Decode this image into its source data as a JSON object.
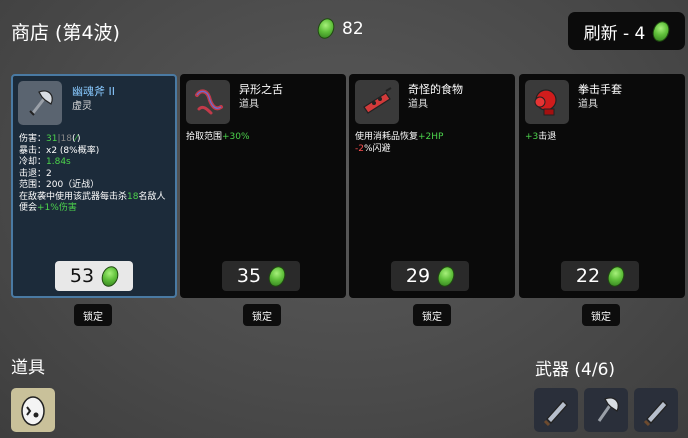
{
  "header": {
    "title": "商店 (第4波)",
    "materials": "82",
    "reroll_label": "刷新 - 4"
  },
  "cards": [
    {
      "name": "幽魂斧 II",
      "type": "虚灵",
      "price": "53",
      "lock_label": "锁定",
      "stats": {
        "dmg_label": "伤害：",
        "dmg_val": "31",
        "dmg_sep": "|",
        "dmg_base": "18",
        "dmg_paren_open": "(",
        "dmg_paren_close": ")",
        "crit": "暴击：x2 (8%概率)",
        "cooldown_label": "冷却：",
        "cooldown_val": "1.84s",
        "knockback": "击退：2",
        "range": "范围：200（近战）",
        "effect_pre": "在敌袭中使用该武器每击杀",
        "effect_num": "18",
        "effect_mid": "名敌人便会",
        "effect_bonus": "+1%伤害"
      }
    },
    {
      "name": "异形之舌",
      "type": "道具",
      "price": "35",
      "lock_label": "锁定",
      "desc_pre": "拾取范围",
      "desc_val": "+30%"
    },
    {
      "name": "奇怪的食物",
      "type": "道具",
      "price": "29",
      "lock_label": "锁定",
      "line1_pre": "使用消耗品恢复",
      "line1_val": "+2HP",
      "line2_val": "-2",
      "line2_post": "%闪避"
    },
    {
      "name": "拳击手套",
      "type": "道具",
      "price": "22",
      "lock_label": "锁定",
      "desc_val": "+3",
      "desc_post": "击退"
    }
  ],
  "items_section": {
    "title": "道具"
  },
  "weapons_section": {
    "title": "武器 (4/6)"
  },
  "colors": {
    "positive": "#4cd34c",
    "negative": "#ff5050",
    "selected_border": "#4a7aa3",
    "material": "#5fbf3a"
  }
}
